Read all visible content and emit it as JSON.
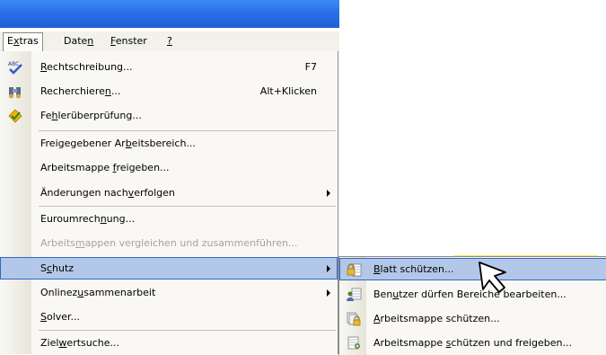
{
  "menubar": {
    "items": [
      {
        "pre": "E",
        "ul": "x",
        "post": "tras"
      },
      {
        "pre": "Date",
        "ul": "n",
        "post": ""
      },
      {
        "pre": "",
        "ul": "F",
        "post": "enster"
      },
      {
        "pre": "",
        "ul": "?",
        "post": ""
      }
    ]
  },
  "menu": {
    "items": [
      {
        "pre": "",
        "ul": "R",
        "post": "echtschreibung...",
        "shortcut": "F7",
        "icon": "spellcheck-icon"
      },
      {
        "pre": "Recherchiere",
        "ul": "n",
        "post": "...",
        "shortcut": "Alt+Klicken",
        "icon": "research-icon"
      },
      {
        "pre": "Fe",
        "ul": "h",
        "post": "lerüberprüfung...",
        "shortcut": "",
        "icon": "error-check-icon"
      },
      {
        "pre": "Freigegebener Ar",
        "ul": "b",
        "post": "eitsbereich...",
        "shortcut": ""
      },
      {
        "pre": "Arbeitsmappe ",
        "ul": "f",
        "post": "reigeben...",
        "shortcut": ""
      },
      {
        "pre": "Änderungen nach",
        "ul": "v",
        "post": "erfolgen",
        "shortcut": ""
      },
      {
        "pre": "Euroumrech",
        "ul": "n",
        "post": "ung...",
        "shortcut": ""
      },
      {
        "pre": "Arbeits",
        "ul": "m",
        "post": "appen vergleichen und zusammenführen...",
        "shortcut": ""
      },
      {
        "pre": "S",
        "ul": "c",
        "post": "hutz",
        "shortcut": ""
      },
      {
        "pre": "Onlinez",
        "ul": "u",
        "post": "sammenarbeit",
        "shortcut": ""
      },
      {
        "pre": "",
        "ul": "S",
        "post": "olver...",
        "shortcut": ""
      },
      {
        "pre": "Ziel",
        "ul": "w",
        "post": "ertsuche...",
        "shortcut": ""
      }
    ]
  },
  "submenu": {
    "items": [
      {
        "pre": "",
        "ul": "B",
        "post": "latt schützen...",
        "icon": "protect-sheet-icon"
      },
      {
        "pre": "Ben",
        "ul": "u",
        "post": "tzer dürfen Bereiche bearbeiten...",
        "icon": "allow-edit-ranges-icon"
      },
      {
        "pre": "",
        "ul": "A",
        "post": "rbeitsmappe schützen...",
        "icon": "protect-workbook-icon"
      },
      {
        "pre": "Arbeitsmappe ",
        "ul": "s",
        "post": "chützen und freigeben...",
        "icon": "protect-share-icon"
      }
    ]
  },
  "colors": {
    "titlebar": "#2a6fe6",
    "highlight": "#b3c7e8",
    "highlight_border": "#3169c6",
    "disabled_text": "#a6a39a"
  }
}
